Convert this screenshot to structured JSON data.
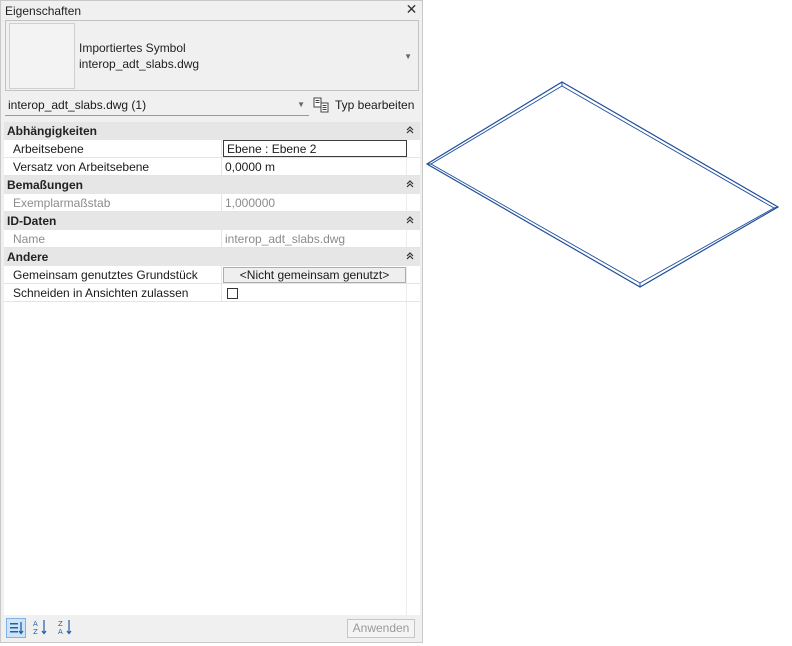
{
  "window": {
    "title": "Eigenschaften"
  },
  "type_preview": {
    "line1": "Importiertes Symbol",
    "line2": "interop_adt_slabs.dwg"
  },
  "type_selector": {
    "value": "interop_adt_slabs.dwg (1)",
    "edit_type_label": "Typ bearbeiten"
  },
  "groups": {
    "constraints": {
      "label": "Abhängigkeiten"
    },
    "dimensions": {
      "label": "Bemaßungen"
    },
    "identity": {
      "label": "ID-Daten"
    },
    "other": {
      "label": "Andere"
    }
  },
  "properties": {
    "work_plane": {
      "name": "Arbeitsebene",
      "value": "Ebene : Ebene 2"
    },
    "offset": {
      "name": "Versatz von Arbeitsebene",
      "value": "0,0000 m"
    },
    "scale": {
      "name": "Exemplarmaßstab",
      "value": "1,000000"
    },
    "name": {
      "name": "Name",
      "value": "interop_adt_slabs.dwg"
    },
    "shared_site": {
      "name": "Gemeinsam genutztes Grundstück",
      "value": "<Nicht gemeinsam genutzt>"
    },
    "cut_in_views": {
      "name": "Schneiden in Ansichten zulassen",
      "checked": false
    }
  },
  "footer": {
    "apply_label": "Anwenden"
  },
  "colors": {
    "selection_blue": "#1f4e9c",
    "group_header": "#e6e6e6",
    "active_button": "#cde3f7"
  }
}
